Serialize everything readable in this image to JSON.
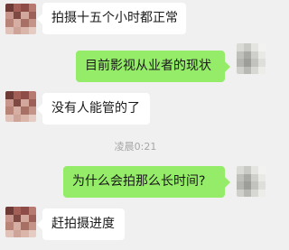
{
  "messages": [
    {
      "side": "in",
      "text": "拍摄十五个小时都正常"
    },
    {
      "side": "out",
      "text": "目前影视从业者的现状"
    },
    {
      "side": "in",
      "text": "没有人能管的了"
    },
    {
      "side": "out",
      "text": "为什么会拍那么长时间?"
    },
    {
      "side": "in",
      "text": "赶拍摄进度"
    }
  ],
  "timestamp": "凌晨0:21",
  "colors": {
    "background": "#f0f0f0",
    "incoming_bubble": "#ffffff",
    "outgoing_bubble": "#95ec69",
    "timestamp_text": "#a6a6a6"
  }
}
